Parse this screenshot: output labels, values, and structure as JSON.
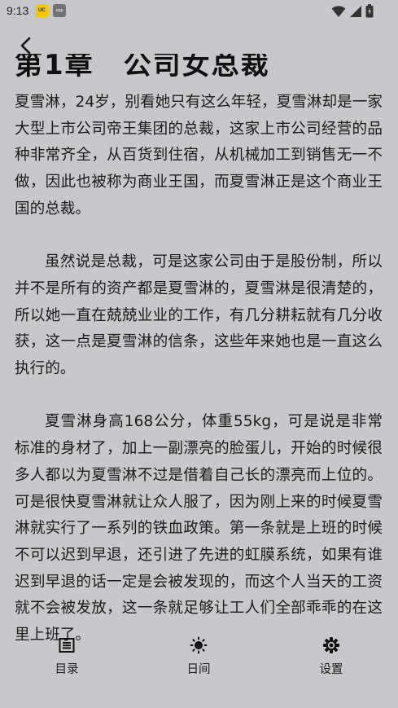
{
  "status_bar": {
    "time": "9:13",
    "app_icons": [
      {
        "name": "uc-browser-icon",
        "text": "UC"
      },
      {
        "name": "notification-app-icon",
        "text": "app"
      }
    ],
    "indicators": [
      "wifi-icon",
      "signal-icon",
      "battery-icon"
    ]
  },
  "reader": {
    "chapter_title": "第1章　公司女总裁",
    "paragraphs": [
      "夏雪淋，24岁，别看她只有这么年轻，夏雪淋却是一家大型上市公司帝王集团的总裁，这家上市公司经营的品种非常齐全，从百货到住宿，从机械加工到销售无一不做，因此也被称为商业王国，而夏雪淋正是这个商业王国的总裁。",
      "虽然说是总裁，可是这家公司由于是股份制，所以并不是所有的资产都是夏雪淋的，夏雪淋是很清楚的，所以她一直在兢兢业业的工作，有几分耕耘就有几分收获，这一点是夏雪淋的信条，这些年来她也是一直这么执行的。",
      "夏雪淋身高168公分，体重55kg，可是说是非常标准的身材了，加上一副漂亮的脸蛋儿，开始的时候很多人都以为夏雪淋不过是借着自己长的漂亮而上位的。可是很快夏雪淋就让众人服了，因为刚上来的时候夏雪淋就实行了一系列的铁血政策。第一条就是上班的时候不可以迟到早退，还引进了先进的虹膜系统，如果有谁迟到早退的话一定是会被发现的，而这个人当天的工资就不会被发放，这一条就足够让工人们全部乖乖的在这里上班了。"
    ]
  },
  "bottom_nav": {
    "items": [
      {
        "label": "目录",
        "icon": "table-of-contents-icon"
      },
      {
        "label": "日间",
        "icon": "sun-icon"
      },
      {
        "label": "设置",
        "icon": "gear-icon"
      }
    ]
  },
  "colors": {
    "background": "#c6c8cb",
    "text": "#1b1b1b"
  }
}
